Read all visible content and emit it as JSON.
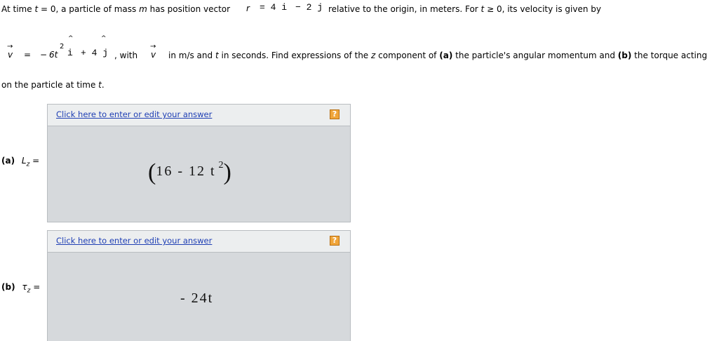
{
  "problem": {
    "line1_intro": "At time ",
    "t_var": "t",
    "line1_eq0": " = 0, a particle of mass ",
    "m_var": "m",
    "line1_pos": " has position vector",
    "r_var": "r",
    "r_expr_1": "= 4 i",
    "r_expr_2": "− 2 j",
    "line1_rest": "relative to the origin, in meters. For ",
    "t_var2": "t",
    "line1_end": " ≥ 0, its velocity is given by",
    "v_var": "v",
    "v_eq": "=",
    "v_minus": "−",
    "v_coef": "6t",
    "v_sup": "2",
    "v_i": "i",
    "v_plus": "+ 4 j",
    "with_text": ", with",
    "v_var2": "v",
    "line2_rest1": "in m/s and ",
    "t_var3": "t",
    "line2_rest2": " in seconds. Find expressions of the ",
    "z_var": "z",
    "line2_rest3": " component of ",
    "part_a_tag": "(a)",
    "line2_rest4": " the particle's angular momentum and ",
    "part_b_tag": "(b)",
    "line2_rest5": " the torque acting",
    "line3": "on the particle at time ",
    "t_var4": "t",
    "line3_end": "."
  },
  "parts": [
    {
      "label": "(a)",
      "symbol": "L",
      "subscript": "z",
      "eq": "=",
      "edit_link": "Click here to enter or edit your answer",
      "help": "?",
      "answer_main": "16 -  12 t",
      "answer_sup": "2"
    },
    {
      "label": "(b)",
      "symbol": "τ",
      "subscript": "z",
      "eq": "=",
      "edit_link": "Click here to enter or edit your answer",
      "help": "?",
      "answer_main": "-  24t"
    }
  ]
}
